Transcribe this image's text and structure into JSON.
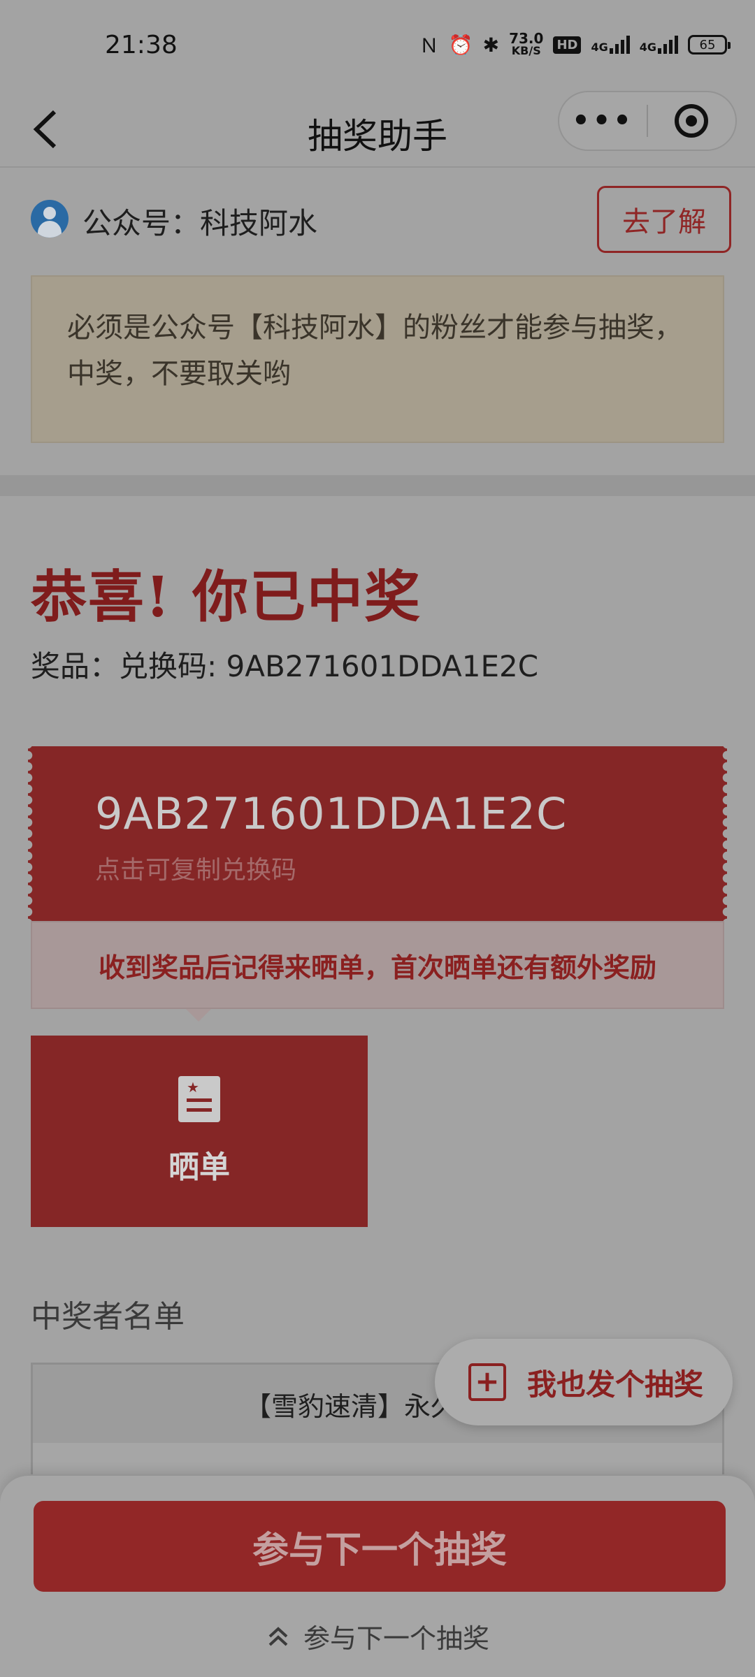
{
  "status_bar": {
    "time": "21:38",
    "net_speed_value": "73.0",
    "net_speed_unit": "KB/S",
    "hd_label": "HD",
    "signal_1": "4G",
    "signal_2": "4G",
    "battery": "65"
  },
  "nav": {
    "title": "抽奖助手",
    "back_icon": "chevron-left-icon",
    "more_icon": "more-dots-icon",
    "close_icon": "target-circle-icon"
  },
  "account": {
    "name": "公众号：科技阿水",
    "learn_button": "去了解"
  },
  "notice": {
    "text": "必须是公众号【科技阿水】的粉丝才能参与抽奖，中奖，不要取关哟"
  },
  "result": {
    "headline": "恭喜! 你已中奖",
    "prize_line": "奖品：兑换码: 9AB271601DDA1E2C",
    "code": "9AB271601DDA1E2C",
    "copy_hint": "点击可复制兑换码"
  },
  "tip": {
    "text": "收到奖品后记得来晒单，首次晒单还有额外奖励"
  },
  "share": {
    "label": "晒单",
    "icon": "document-star-icon"
  },
  "winners": {
    "title": "中奖者名单",
    "first_row": "【雪豹速清】永久会员"
  },
  "float_button": {
    "label": "我也发个抽奖",
    "icon": "plus-square-icon"
  },
  "bottom": {
    "primary_button": "参与下一个抽奖",
    "link": "参与下一个抽奖",
    "link_icon": "double-chevron-up-icon"
  },
  "colors": {
    "accent_red": "#852626",
    "overlay_gray": "#a3a3a3"
  }
}
